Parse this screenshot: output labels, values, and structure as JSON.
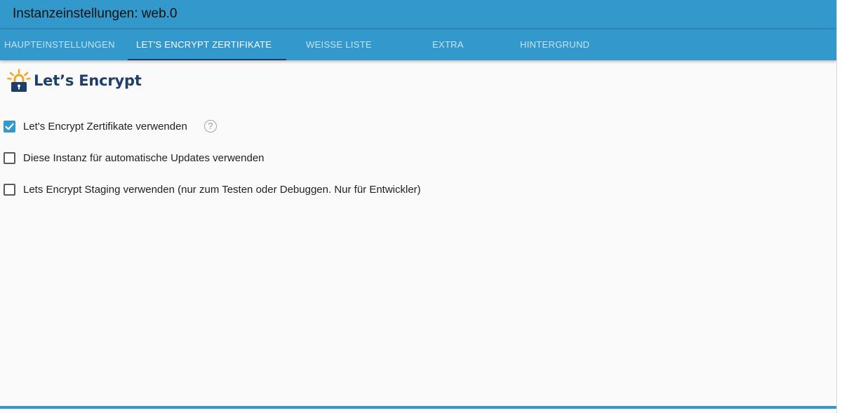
{
  "window": {
    "title": "Instanzeinstellungen: web.0"
  },
  "tabs": [
    {
      "label": "HAUPTEINSTELLUNGEN",
      "active": false
    },
    {
      "label": "LET'S ENCRYPT ZERTIFIKATE",
      "active": true
    },
    {
      "label": "WEISSE LISTE",
      "active": false
    },
    {
      "label": "EXTRA",
      "active": false
    },
    {
      "label": "HINTERGRUND",
      "active": false
    }
  ],
  "logo": {
    "text": "Let’s Encrypt",
    "icon": "lets-encrypt-lock-icon"
  },
  "options": [
    {
      "label": "Let's Encrypt Zertifikate verwenden",
      "checked": true,
      "has_help": true
    },
    {
      "label": "Diese Instanz für automatische Updates verwenden",
      "checked": false,
      "has_help": false
    },
    {
      "label": "Lets Encrypt Staging verwenden (nur zum Testen oder Debuggen. Nur für Entwickler)",
      "checked": false,
      "has_help": false
    }
  ],
  "help": {
    "symbol": "?"
  },
  "colors": {
    "primary": "#3399cc",
    "tab_indicator": "#1a3b6e",
    "logo_text": "#1f3f6b",
    "logo_orange": "#f5a623"
  }
}
